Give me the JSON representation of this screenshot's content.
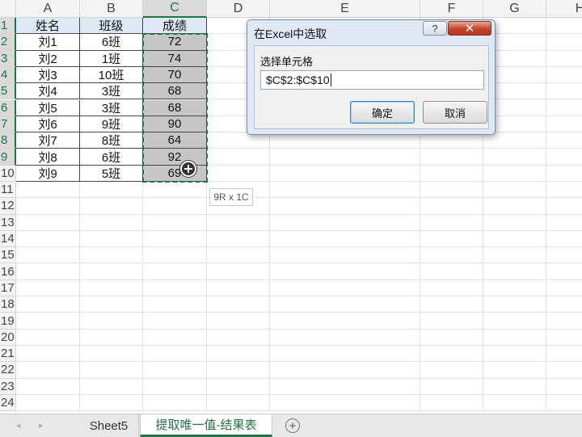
{
  "columns": [
    "A",
    "B",
    "C",
    "D",
    "E",
    "F",
    "G",
    "H"
  ],
  "row_numbers": [
    "1",
    "2",
    "3",
    "4",
    "5",
    "6",
    "7",
    "8",
    "9",
    "10",
    "11",
    "12",
    "13",
    "14",
    "15",
    "16",
    "17",
    "18",
    "19",
    "20",
    "21",
    "22",
    "23",
    "24"
  ],
  "table": {
    "headers": [
      "姓名",
      "班级",
      "成绩"
    ],
    "rows": [
      [
        "刘1",
        "6班",
        "72"
      ],
      [
        "刘2",
        "1班",
        "74"
      ],
      [
        "刘3",
        "10班",
        "70"
      ],
      [
        "刘4",
        "3班",
        "68"
      ],
      [
        "刘5",
        "3班",
        "68"
      ],
      [
        "刘6",
        "9班",
        "90"
      ],
      [
        "刘7",
        "8班",
        "64"
      ],
      [
        "刘8",
        "6班",
        "92"
      ],
      [
        "刘9",
        "5班",
        "69"
      ]
    ]
  },
  "selection_tooltip": "9R x 1C",
  "dialog": {
    "title": "在Excel中选取",
    "help_label": "?",
    "close_label": "✕",
    "field_label": "选择单元格",
    "field_value": "$C$2:$C$10",
    "ok_label": "确定",
    "cancel_label": "取消"
  },
  "sheet_tabs": {
    "nav_prev": "◂",
    "nav_next": "▸",
    "tabs": [
      "Sheet5",
      "提取唯一值-结果表"
    ],
    "active_index": 1,
    "add_label": "+"
  },
  "colors": {
    "accent": "#217346",
    "header_fill": "#dce9f5",
    "selected_fill": "#c6c6c6"
  }
}
